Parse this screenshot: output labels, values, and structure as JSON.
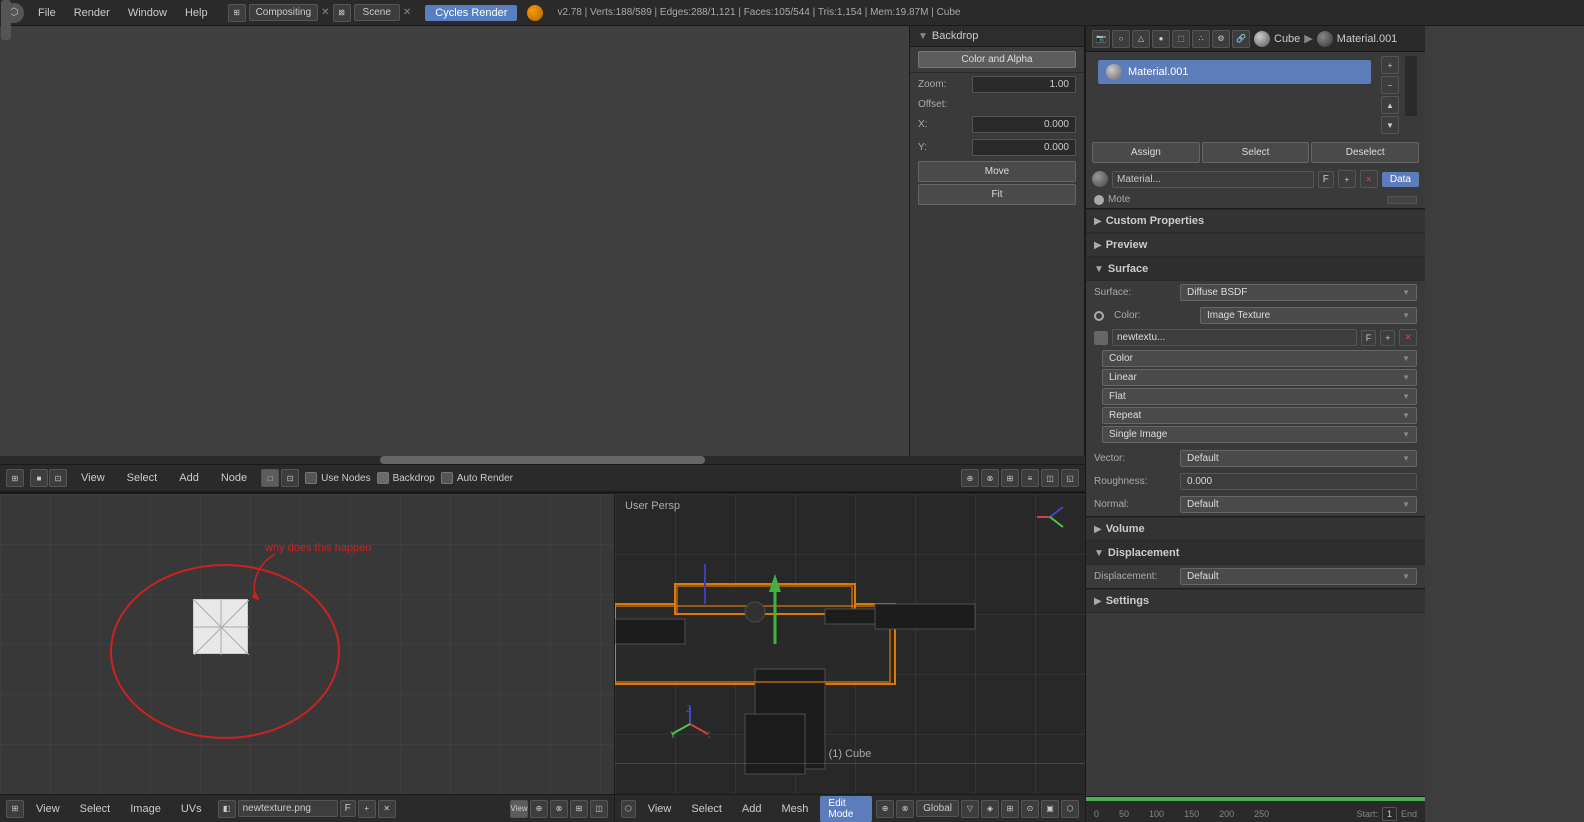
{
  "topbar": {
    "icon": "⬡",
    "menus": [
      "File",
      "Render",
      "Window",
      "Help"
    ],
    "editor_icon": "⊞",
    "editor_type": "Compositing",
    "scene_icon": "⊠",
    "scene": "Scene",
    "render_engine": "Cycles Render",
    "info": "v2.78 | Verts:188/589 | Edges:288/1,121 | Faces:105/544 | Tris:1,154 | Mem:19.87M | Cube"
  },
  "backdrop": {
    "title": "Backdrop",
    "color_alpha_label": "Color and Alpha",
    "zoom_label": "Zoom:",
    "zoom_value": "1.00",
    "offset_label": "Offset:",
    "x_label": "X:",
    "x_value": "0.000",
    "y_label": "Y:",
    "y_value": "0.000",
    "move_btn": "Move",
    "fit_btn": "Fit"
  },
  "comp_toolbar": {
    "view": "View",
    "select": "Select",
    "add": "Add",
    "node": "Node",
    "use_nodes": "Use Nodes",
    "backdrop": "Backdrop",
    "auto_render": "Auto Render"
  },
  "material": {
    "cube_label": "Cube",
    "material_name": "Material.001",
    "assign_btn": "Assign",
    "select_btn": "Select",
    "deselect_btn": "Deselect",
    "mat_field": "Material...",
    "f_btn": "F",
    "data_btn": "Data",
    "custom_properties": "Custom Properties",
    "preview": "Preview",
    "surface_title": "Surface",
    "surface_label": "Surface:",
    "surface_value": "Diffuse BSDF",
    "color_label": "Color:",
    "color_value": "Image Texture",
    "color_sub_name": "newtextu...",
    "color_sub_f": "F",
    "color_field1": "Color",
    "color_field2": "Linear",
    "color_field3": "Flat",
    "color_field4": "Repeat",
    "color_field5": "Single Image",
    "vector_label": "Vector:",
    "vector_value": "Default",
    "roughness_label": "Roughness:",
    "roughness_value": "0.000",
    "normal_label": "Normal:",
    "normal_value": "Default",
    "volume_title": "Volume",
    "displacement_title": "Displacement",
    "displacement_label": "Displacement:",
    "displacement_value": "Default",
    "settings_title": "Settings",
    "mote_label": "Mote"
  },
  "uv_editor": {
    "annotation": "why does this happen",
    "view_menu": "View",
    "select_menu": "Select",
    "image_menu": "Image",
    "uvs_menu": "UVs",
    "texture_name": "newtexture.png",
    "f_btn": "F",
    "view_btn": "View"
  },
  "viewport_3d": {
    "label": "User Persp",
    "cube_label": "(1) Cube",
    "view_menu": "View",
    "select_menu": "Select",
    "add_menu": "Add",
    "mesh_menu": "Mesh",
    "mode": "Edit Mode",
    "global_label": "Global"
  },
  "timeline": {
    "start": "Start:",
    "start_val": "1",
    "end": "End",
    "markers": [
      "0",
      "50",
      "100",
      "150",
      "200",
      "250"
    ]
  }
}
